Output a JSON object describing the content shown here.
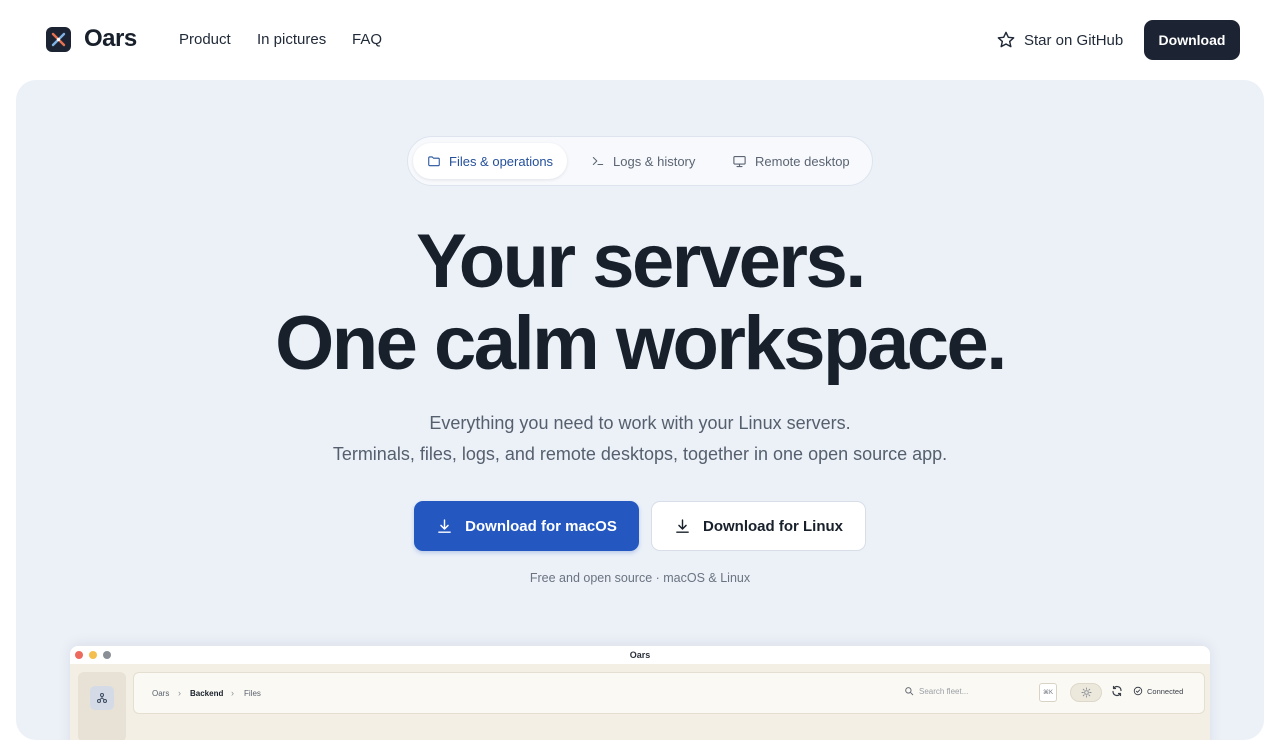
{
  "nav": {
    "brand": "Oars",
    "links": [
      "Product",
      "In pictures",
      "FAQ"
    ],
    "github_label": "Star on GitHub",
    "download_label": "Download"
  },
  "hero": {
    "tabs": [
      {
        "label": "Files & operations",
        "icon": "folder-icon",
        "active": true
      },
      {
        "label": "Logs & history",
        "icon": "terminal-icon",
        "active": false
      },
      {
        "label": "Remote desktop",
        "icon": "monitor-icon",
        "active": false
      }
    ],
    "headline_line1": "Your servers.",
    "headline_line2": "One calm workspace.",
    "subtitle_line1": "Everything you need to work with your Linux servers.",
    "subtitle_line2": "Terminals, files, logs, and remote desktops, together in one open source app.",
    "download_mac": "Download for macOS",
    "download_linux": "Download for Linux",
    "footnote": "Free and open source · macOS & Linux"
  },
  "app_preview": {
    "window_title": "Oars",
    "breadcrumb": [
      "Oars",
      "Backend",
      "Files"
    ],
    "search_placeholder": "Search fleet...",
    "shortcut": "⌘K",
    "status": "Connected"
  },
  "colors": {
    "primary": "#2458c0",
    "dark": "#1c2433",
    "hero_bg": "#ecf1f8",
    "traffic_red": "#ec6a5e",
    "traffic_yellow": "#f4bf4f",
    "traffic_gray": "#8a8f96"
  }
}
